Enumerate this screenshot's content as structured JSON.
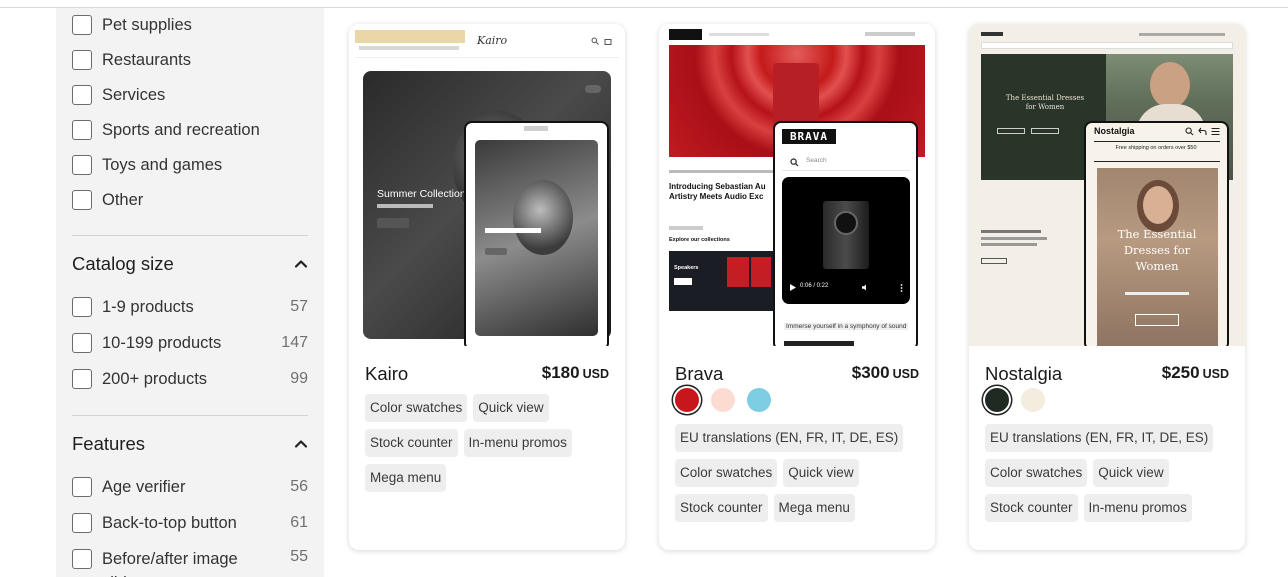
{
  "filters": {
    "category_items": [
      {
        "label": "Pet supplies"
      },
      {
        "label": "Restaurants"
      },
      {
        "label": "Services"
      },
      {
        "label": "Sports and recreation"
      },
      {
        "label": "Toys and games"
      },
      {
        "label": "Other"
      }
    ],
    "catalog_size": {
      "title": "Catalog size",
      "items": [
        {
          "label": "1-9 products",
          "count": "57"
        },
        {
          "label": "10-199 products",
          "count": "147"
        },
        {
          "label": "200+ products",
          "count": "99"
        }
      ]
    },
    "features": {
      "title": "Features",
      "items": [
        {
          "label": "Age verifier",
          "count": "56"
        },
        {
          "label": "Back-to-top button",
          "count": "61"
        },
        {
          "label": "Before/after image slider",
          "count": "55"
        }
      ]
    }
  },
  "themes": [
    {
      "name": "Kairo",
      "price": "$180",
      "currency": "USD",
      "swatches": [],
      "tags": [
        "Color swatches",
        "Quick view",
        "Stock counter",
        "In-menu promos",
        "Mega menu"
      ],
      "preview": {
        "logo": "Kairo",
        "hero_heading": "Summer Collection"
      }
    },
    {
      "name": "Brava",
      "price": "$300",
      "currency": "USD",
      "swatches": [
        "#c8161d",
        "#fcdcd1",
        "#7dcde3"
      ],
      "tags": [
        "EU translations (EN, FR, IT, DE, ES)",
        "Color swatches",
        "Quick view",
        "Stock counter",
        "Mega menu"
      ],
      "preview": {
        "logo": "BRAVA",
        "search_placeholder": "Search",
        "headline": "Introducing Sebastian Au Artistry Meets Audio Exc",
        "section": "Explore our collections",
        "collection": "Speakers",
        "video_time": "0:06 / 0:22",
        "caption": "Immerse yourself in a symphony of sound"
      }
    },
    {
      "name": "Nostalgia",
      "price": "$250",
      "currency": "USD",
      "swatches": [
        "#1f2b22",
        "#f3ecdf"
      ],
      "tags": [
        "EU translations (EN, FR, IT, DE, ES)",
        "Color swatches",
        "Quick view",
        "Stock counter",
        "In-menu promos"
      ],
      "preview": {
        "logo": "Nostalgia",
        "desktop_heading": "The Essential Dresses for Women",
        "announcement": "Free shipping on orders over $50",
        "mobile_heading": "The Essential Dresses for Women"
      }
    }
  ],
  "colors": {
    "sidebar_bg": "#f3f3f3",
    "tag_bg": "#eeeeee"
  }
}
